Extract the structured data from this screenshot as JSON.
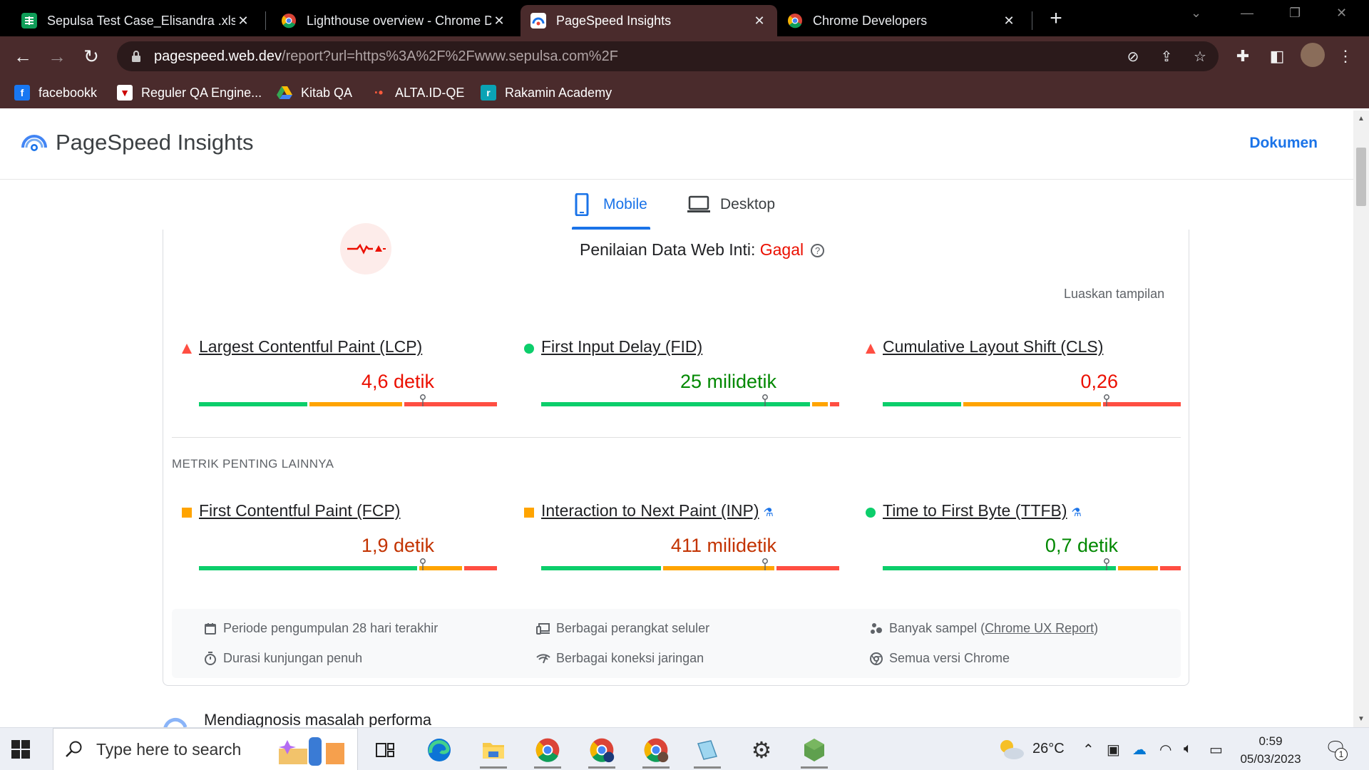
{
  "browser": {
    "tabs": [
      {
        "title": "Sepulsa Test Case_Elisandra .xlsx",
        "favicon": "sheets-icon",
        "active": false
      },
      {
        "title": "Lighthouse overview - Chrome D",
        "favicon": "chrome-icon",
        "active": false
      },
      {
        "title": "PageSpeed Insights",
        "favicon": "pagespeed-icon",
        "active": true
      },
      {
        "title": "Chrome Developers",
        "favicon": "chrome-icon",
        "active": false
      }
    ],
    "url_host": "pagespeed.web.dev",
    "url_path": "/report?url=https%3A%2F%2Fwww.sepulsa.com%2F",
    "bookmarks": [
      {
        "label": "facebookk",
        "icon": "facebook-icon"
      },
      {
        "label": "Reguler QA Engine...",
        "icon": "bookmark-icon"
      },
      {
        "label": "Kitab QA",
        "icon": "drive-icon"
      },
      {
        "label": "ALTA.ID-QE",
        "icon": "alta-icon"
      },
      {
        "label": "Rakamin Academy",
        "icon": "rakamin-icon"
      }
    ]
  },
  "psi": {
    "title": "PageSpeed Insights",
    "docs_link": "Dokumen",
    "device_tabs": [
      {
        "label": "Mobile",
        "active": true
      },
      {
        "label": "Desktop",
        "active": false
      }
    ],
    "assessment_label": "Penilaian Data Web Inti: ",
    "assessment_result": "Gagal",
    "expand_view": "Luaskan tampilan",
    "other_metrics_heading": "METRIK PENTING LAINNYA",
    "core_metrics": [
      {
        "label": "Largest Contentful Paint (LCP)",
        "value": "4,6 detik",
        "rating": "poor",
        "experimental": false,
        "distribution": {
          "good": 0.37,
          "average": 0.32,
          "poor": 0.31
        },
        "marker": 0.75
      },
      {
        "label": "First Input Delay (FID)",
        "value": "25 milidetik",
        "rating": "good",
        "experimental": false,
        "distribution": {
          "good": 0.91,
          "average": 0.06,
          "poor": 0.03
        },
        "marker": 0.75
      },
      {
        "label": "Cumulative Layout Shift (CLS)",
        "value": "0,26",
        "rating": "poor",
        "experimental": false,
        "distribution": {
          "good": 0.27,
          "average": 0.47,
          "poor": 0.26
        },
        "marker": 0.75
      }
    ],
    "other_metrics": [
      {
        "label": "First Contentful Paint (FCP)",
        "value": "1,9 detik",
        "rating": "average",
        "experimental": false,
        "distribution": {
          "good": 0.74,
          "average": 0.15,
          "poor": 0.11
        },
        "marker": 0.75
      },
      {
        "label": "Interaction to Next Paint (INP)",
        "value": "411 milidetik",
        "rating": "average",
        "experimental": true,
        "distribution": {
          "good": 0.41,
          "average": 0.38,
          "poor": 0.21
        },
        "marker": 0.75
      },
      {
        "label": "Time to First Byte (TTFB)",
        "value": "0,7 detik",
        "rating": "good",
        "experimental": true,
        "distribution": {
          "good": 0.79,
          "average": 0.14,
          "poor": 0.07
        },
        "marker": 0.75
      }
    ],
    "info": [
      {
        "icon": "calendar-icon",
        "text": "Periode pengumpulan 28 hari terakhir"
      },
      {
        "icon": "devices-icon",
        "text": "Berbagai perangkat seluler"
      },
      {
        "icon": "samples-icon",
        "text_before": "Banyak sampel (",
        "link": "Chrome UX Report",
        "text_after": ")"
      },
      {
        "icon": "timer-icon",
        "text": "Durasi kunjungan penuh"
      },
      {
        "icon": "network-icon",
        "text": "Berbagai koneksi jaringan"
      },
      {
        "icon": "chrome-versions-icon",
        "text": "Semua versi Chrome"
      }
    ],
    "diagnose_peek": "Mendiagnosis masalah performa"
  },
  "taskbar": {
    "search_placeholder": "Type here to search",
    "temperature": "26°C",
    "time": "0:59",
    "date": "05/03/2023",
    "notifications": "1"
  },
  "colors": {
    "good": "#0cce6b",
    "average": "#ffa400",
    "poor": "#ff4e42",
    "accent": "#1a73e8",
    "chrome_frame": "#4a2b2c"
  }
}
